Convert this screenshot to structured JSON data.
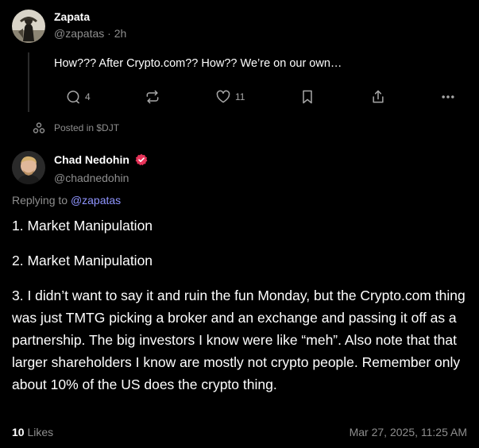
{
  "parent_post": {
    "author_name": "Zapata",
    "handle_time": "@zapatas · 2h",
    "text": "How??? After Crypto.com?? How?? We’re on our own…",
    "reply_count": "4",
    "like_count": "11",
    "posted_in": "Posted in $DJT",
    "icons": [
      "reply-icon",
      "repost-icon",
      "like-icon",
      "bookmark-icon",
      "share-icon",
      "more-icon",
      "community-icon"
    ]
  },
  "reply_post": {
    "author_name": "Chad Nedohin",
    "handle": "@chadnedohin",
    "replying_prefix": "Replying to",
    "replying_to": "@zapatas",
    "paragraphs": [
      "1. Market Manipulation",
      "2. Market Manipulation",
      "3. I didn’t want to say it and ruin the fun Monday, but the Crypto.com thing was just TMTG picking a broker and an exchange and passing it off as a partnership. The big investors I know were like “meh”. Also note that that larger shareholders I know are mostly not crypto people. Remember only about 10% of the US does the crypto thing."
    ],
    "likes_count": "10",
    "likes_label": "Likes",
    "timestamp": "Mar 27, 2025, 11:25 AM",
    "verified_color": "#e8345a"
  }
}
